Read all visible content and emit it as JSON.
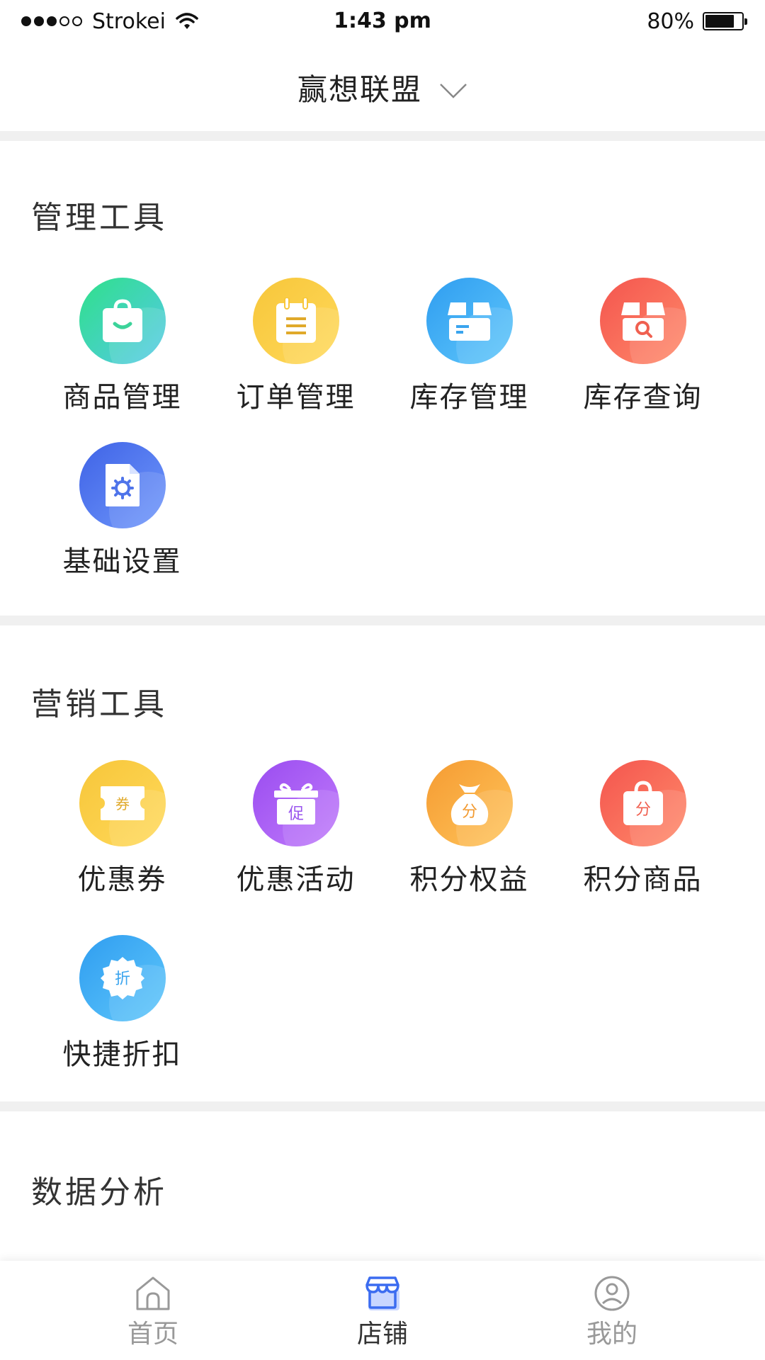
{
  "status_bar": {
    "carrier": "Strokei",
    "time": "1:43 pm",
    "battery": "80%",
    "battery_level": 0.8
  },
  "header": {
    "title": "赢想联盟",
    "dropdown_icon": "chevron-down-icon"
  },
  "sections": {
    "management": {
      "title": "管理工具",
      "items": [
        {
          "label": "商品管理",
          "icon": "shopping-bag-icon",
          "color_from": "#2fe08a",
          "color_to": "#55c9e8"
        },
        {
          "label": "订单管理",
          "icon": "order-notepad-icon",
          "color_from": "#f7c63a",
          "color_to": "#ffd95a"
        },
        {
          "label": "库存管理",
          "icon": "inventory-box-icon",
          "color_from": "#2f9df0",
          "color_to": "#5fc7fb"
        },
        {
          "label": "库存查询",
          "icon": "inventory-search-icon",
          "color_from": "#f4554e",
          "color_to": "#ff8a6a"
        },
        {
          "label": "基础设置",
          "icon": "settings-document-icon",
          "color_from": "#3f63e6",
          "color_to": "#6f97fb"
        }
      ]
    },
    "marketing": {
      "title": "营销工具",
      "items": [
        {
          "label": "优惠券",
          "icon": "coupon-icon",
          "glyph": "券",
          "color_from": "#f7c63a",
          "color_to": "#ffd95a"
        },
        {
          "label": "优惠活动",
          "icon": "promotion-gift-icon",
          "glyph": "促",
          "color_from": "#9a4cf0",
          "color_to": "#c07bfb"
        },
        {
          "label": "积分权益",
          "icon": "points-moneybag-icon",
          "glyph": "分",
          "color_from": "#f59b32",
          "color_to": "#ffc45a"
        },
        {
          "label": "积分商品",
          "icon": "points-bag-icon",
          "glyph": "分",
          "color_from": "#f4554e",
          "color_to": "#ff8a6a"
        },
        {
          "label": "快捷折扣",
          "icon": "discount-badge-icon",
          "glyph": "折",
          "color_from": "#2f9df0",
          "color_to": "#5fc7fb"
        }
      ]
    },
    "analytics": {
      "title": "数据分析"
    }
  },
  "tabbar": {
    "items": [
      {
        "label": "首页",
        "icon": "home-icon",
        "active": false
      },
      {
        "label": "店铺",
        "icon": "store-icon",
        "active": true
      },
      {
        "label": "我的",
        "icon": "profile-icon",
        "active": false
      }
    ],
    "active_color": "#3b6cf0",
    "inactive_color": "#999999"
  }
}
